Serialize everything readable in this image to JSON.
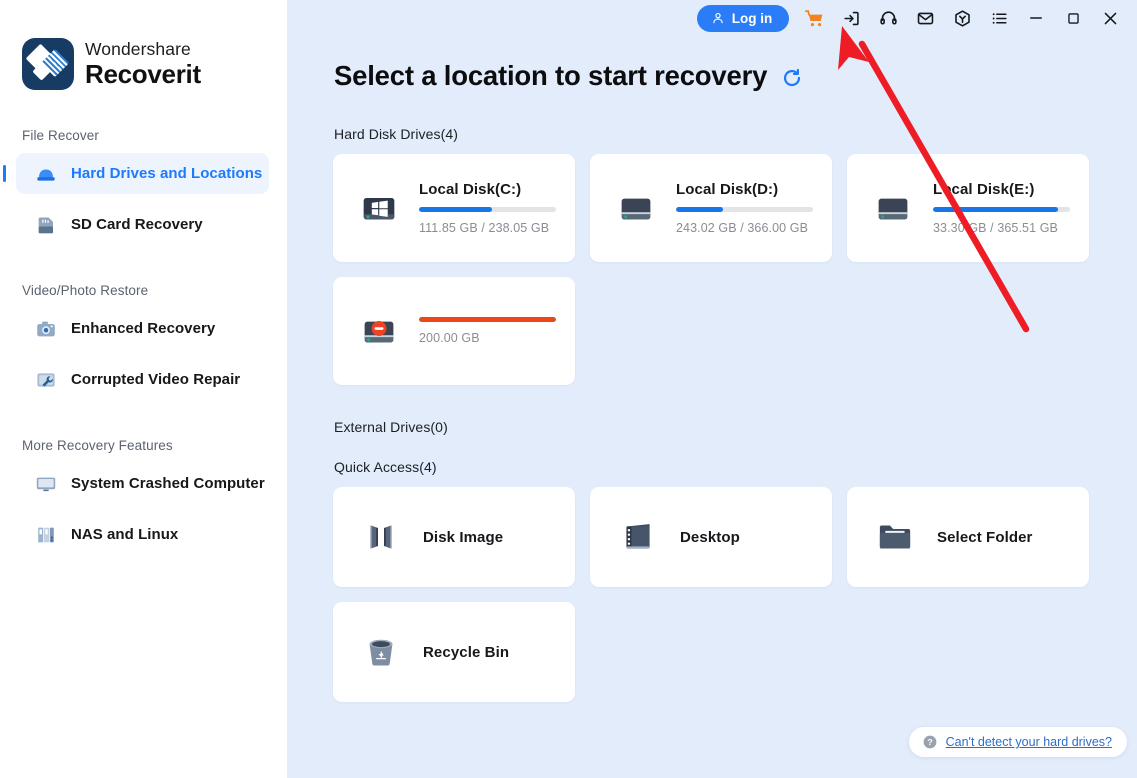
{
  "app": {
    "brand_top": "Wondershare",
    "brand_bottom": "Recoverit"
  },
  "titlebar": {
    "login_label": "Log in",
    "icons": [
      {
        "name": "user-icon",
        "glyph": "user"
      },
      {
        "name": "shopping-cart-icon",
        "glyph": "cart",
        "color": "#f58220"
      },
      {
        "name": "sign-in-icon",
        "glyph": "signin"
      },
      {
        "name": "headset-support-icon",
        "glyph": "headset"
      },
      {
        "name": "mail-icon",
        "glyph": "mail"
      },
      {
        "name": "box-product-icon",
        "glyph": "box"
      },
      {
        "name": "menu-list-icon",
        "glyph": "list"
      },
      {
        "name": "minimize-icon",
        "glyph": "minimize"
      },
      {
        "name": "maximize-icon",
        "glyph": "maximize"
      },
      {
        "name": "close-icon",
        "glyph": "close"
      }
    ]
  },
  "sidebar": {
    "groups": [
      {
        "label": "File Recover",
        "items": [
          {
            "label": "Hard Drives and Locations",
            "icon": "hard-drive-icon",
            "active": true
          },
          {
            "label": "SD Card Recovery",
            "icon": "sd-card-icon",
            "active": false
          }
        ]
      },
      {
        "label": "Video/Photo Restore",
        "items": [
          {
            "label": "Enhanced Recovery",
            "icon": "camera-icon",
            "active": false
          },
          {
            "label": "Corrupted Video Repair",
            "icon": "video-repair-icon",
            "active": false
          }
        ]
      },
      {
        "label": "More Recovery Features",
        "items": [
          {
            "label": "System Crashed Computer",
            "icon": "monitor-icon",
            "active": false
          },
          {
            "label": "NAS and Linux",
            "icon": "server-icon",
            "active": false
          }
        ]
      }
    ]
  },
  "main": {
    "page_title": "Select a location to start recovery",
    "refresh_icon": "refresh-icon",
    "sections": {
      "hard_disk_drives_label": "Hard Disk Drives(4)",
      "external_drives_label": "External Drives(0)",
      "quick_access_label": "Quick Access(4)"
    },
    "drives": [
      {
        "name": "Local Disk(C:)",
        "size": "111.85 GB / 238.05 GB",
        "percent": 53,
        "icon": "windows-drive-icon",
        "state": "normal"
      },
      {
        "name": "Local Disk(D:)",
        "size": "243.02 GB / 366.00 GB",
        "percent": 34,
        "icon": "hdd-icon",
        "state": "normal"
      },
      {
        "name": "Local Disk(E:)",
        "size": "33.30 GB / 365.51 GB",
        "percent": 91,
        "icon": "hdd-icon",
        "state": "normal"
      },
      {
        "name": "",
        "size": "200.00 GB",
        "percent": 100,
        "icon": "lost-partition-icon",
        "state": "danger"
      }
    ],
    "quick_access": [
      {
        "label": "Disk Image",
        "icon": "disk-image-icon"
      },
      {
        "label": "Desktop",
        "icon": "desktop-icon"
      },
      {
        "label": "Select Folder",
        "icon": "folder-icon"
      },
      {
        "label": "Recycle Bin",
        "icon": "recycle-bin-icon"
      }
    ],
    "help": {
      "icon": "question-mark-icon",
      "text": "Can't detect your hard drives?"
    }
  },
  "annotation": {
    "type": "arrow",
    "color": "#ee1c25",
    "points_to": "shopping-cart-icon"
  }
}
